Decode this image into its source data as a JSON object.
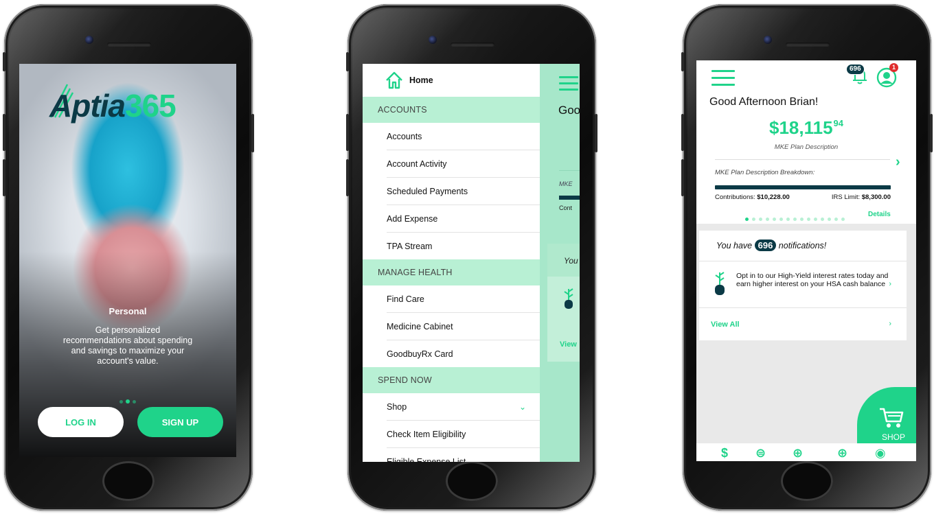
{
  "phone1": {
    "logo_a": "Aptia",
    "logo_b": "365",
    "slide_title": "Personal",
    "slide_text": "Get personalized recommendations about spending and savings to maximize your account's value.",
    "login_label": "LOG IN",
    "signup_label": "SIGN UP",
    "carousel": {
      "count": 3,
      "active": 2
    }
  },
  "phone2": {
    "home_label": "Home",
    "behind_greeting": "Goo",
    "behind_plan": "MKE",
    "behind_contrib": "Cont",
    "behind_notif": "You",
    "behind_viewall": "View",
    "sections": [
      {
        "title": "ACCOUNTS",
        "items": [
          "Accounts",
          "Account Activity",
          "Scheduled Payments",
          "Add Expense",
          "TPA Stream"
        ]
      },
      {
        "title": "MANAGE HEALTH",
        "items": [
          "Find Care",
          "Medicine Cabinet",
          "GoodbuyRx Card"
        ]
      },
      {
        "title": "SPEND NOW",
        "items": [
          "Shop",
          "Check Item Eligibility",
          "Eligible Expense List"
        ]
      }
    ]
  },
  "phone3": {
    "notification_badge": "696",
    "profile_badge": "1",
    "greeting": "Good Afternoon Brian!",
    "amount_main": "$18,115",
    "amount_cents": "94",
    "plan_description": "MKE Plan Description",
    "breakdown_label": "MKE Plan Description Breakdown:",
    "contributions_label": "Contributions: ",
    "contributions_value": "$10,228.00",
    "irs_label": "IRS Limit: ",
    "irs_value": "$8,300.00",
    "details_label": "Details",
    "carousel": {
      "count": 15,
      "active": 1
    },
    "notif_prefix": "You have ",
    "notif_count": "696",
    "notif_suffix": " notifications!",
    "notif_message": "Opt in to our High-Yield interest rates today and earn higher interest on your HSA cash balance",
    "view_all": "View All",
    "shop_label": "SHOP"
  },
  "colors": {
    "accent": "#1fd38a",
    "dark": "#0b3a46",
    "menu_section": "#b8f0d4",
    "alert": "#e02d2d"
  }
}
